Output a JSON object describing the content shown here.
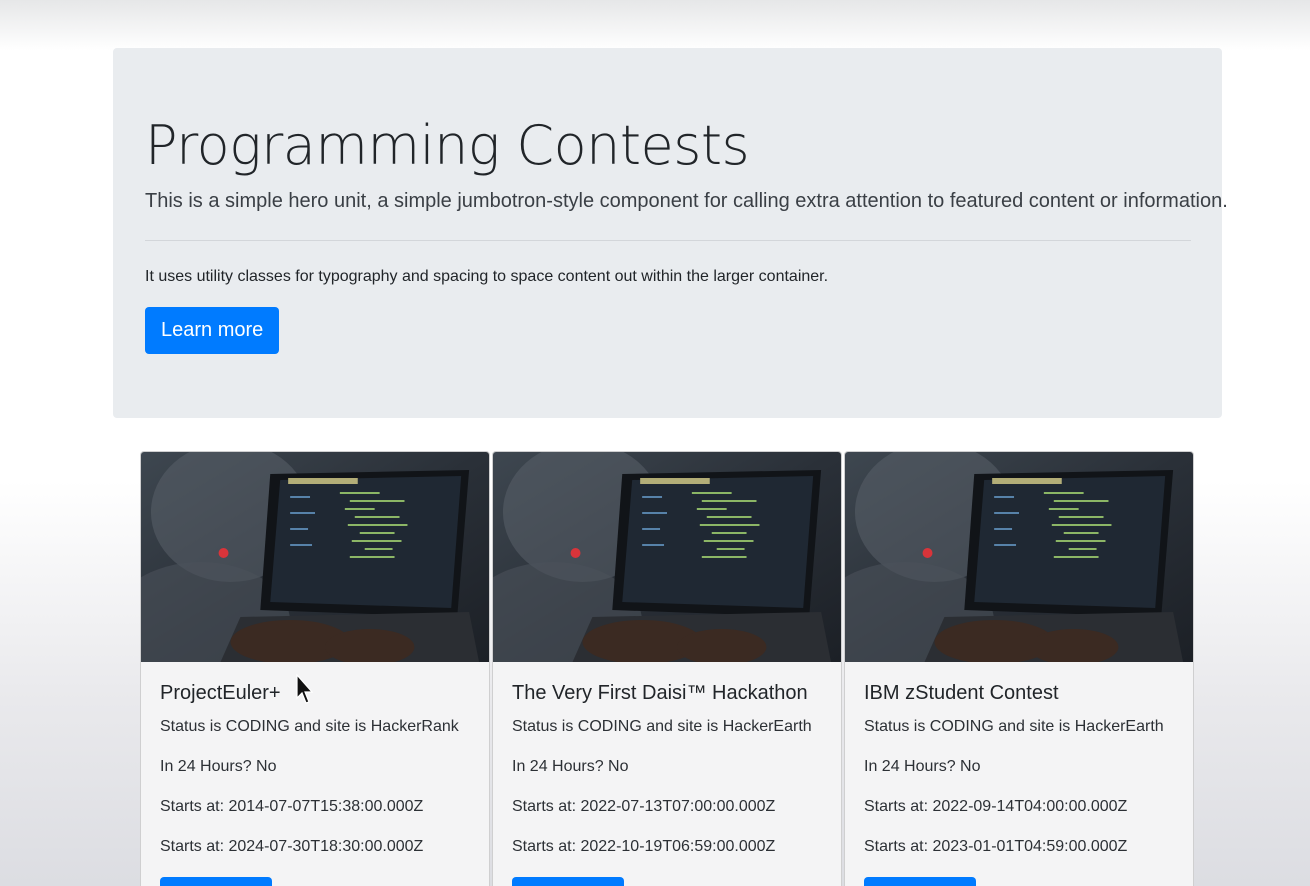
{
  "jumbotron": {
    "title": "Programming Contests",
    "lead": "This is a simple hero unit, a simple jumbotron-style component for calling extra attention to featured content or information.",
    "text": "It uses utility classes for typography and spacing to space content out within the larger container.",
    "button_label": "Learn more"
  },
  "colors": {
    "primary": "#007bff",
    "jumbotron_bg": "#e9ecef"
  },
  "cards": [
    {
      "title": "ProjectEuler+",
      "status": "Status is CODING and site is HackerRank",
      "in24": "In 24 Hours? No",
      "start": "Starts at: 2014-07-07T15:38:00.000Z",
      "end": "Starts at: 2024-07-30T18:30:00.000Z",
      "image": "programmer-at-laptop-photo"
    },
    {
      "title": "The Very First Daisi™ Hackathon",
      "status": "Status is CODING and site is HackerEarth",
      "in24": "In 24 Hours? No",
      "start": "Starts at: 2022-07-13T07:00:00.000Z",
      "end": "Starts at: 2022-10-19T06:59:00.000Z",
      "image": "programmer-at-laptop-photo"
    },
    {
      "title": "IBM zStudent Contest",
      "status": "Status is CODING and site is HackerEarth",
      "in24": "In 24 Hours? No",
      "start": "Starts at: 2022-09-14T04:00:00.000Z",
      "end": "Starts at: 2023-01-01T04:59:00.000Z",
      "image": "programmer-at-laptop-photo"
    }
  ]
}
